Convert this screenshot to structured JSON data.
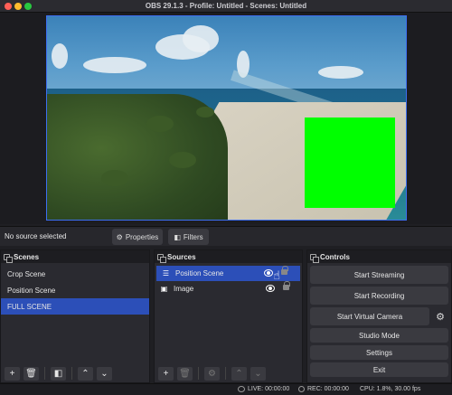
{
  "window": {
    "title": "OBS 29.1.3 - Profile: Untitled - Scenes: Untitled"
  },
  "source_bar": {
    "status": "No source selected",
    "properties_label": "Properties",
    "filters_label": "Filters"
  },
  "scenes": {
    "header": "Scenes",
    "items": [
      {
        "label": "Crop Scene",
        "selected": false
      },
      {
        "label": "Position Scene",
        "selected": false
      },
      {
        "label": "FULL SCENE",
        "selected": true
      }
    ]
  },
  "sources": {
    "header": "Sources",
    "items": [
      {
        "label": "Position Scene",
        "icon": "scene-list-icon",
        "selected": true
      },
      {
        "label": "Image",
        "icon": "image-icon",
        "selected": false
      }
    ]
  },
  "controls": {
    "header": "Controls",
    "start_streaming": "Start Streaming",
    "start_recording": "Start Recording",
    "start_virtual_camera": "Start Virtual Camera",
    "studio_mode": "Studio Mode",
    "settings": "Settings",
    "exit": "Exit"
  },
  "status": {
    "live": "LIVE: 00:00:00",
    "rec": "REC: 00:00:00",
    "cpu": "CPU: 1.8%, 30.00 fps"
  },
  "colors": {
    "accent": "#2c4fb8",
    "preview_border": "#3d6ef2",
    "green_source": "#00ff00"
  }
}
